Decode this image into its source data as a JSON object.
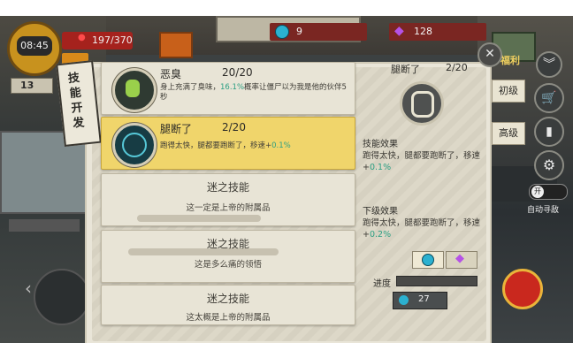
{
  "hud": {
    "time": "08:45",
    "health": "197/370",
    "level": "13",
    "coins": "9",
    "gems": "128"
  },
  "right_menu": {
    "welfare": "福利",
    "beginner": "初级",
    "advanced": "高级",
    "toggle_on": "开",
    "auto_path": "自动寻敌"
  },
  "panel": {
    "title": "技能开发"
  },
  "skills": [
    {
      "name": "恶臭",
      "level": "20/20",
      "desc_a": "身上充满了臭味，",
      "desc_hl": "16.1%",
      "desc_b": "概率让僵尸以为我是他的伙伴5秒"
    },
    {
      "name": "腿断了",
      "level": "2/20",
      "desc_a": "跑得太快，腿都要跑断了，移速+",
      "desc_hl": "0.1%"
    },
    {
      "name": "迷之技能",
      "desc": "这一定是上帝的附属品"
    },
    {
      "name": "迷之技能",
      "desc": "这是多么痛的领悟"
    },
    {
      "name": "迷之技能",
      "desc": "这太概是上帝的附属品"
    }
  ],
  "detail": {
    "name": "腿断了",
    "level": "2/20",
    "effect_heading": "技能效果",
    "effect_a": "跑得太快，腿都要跑断了，移速+",
    "effect_hl": "0.1%",
    "next_heading": "下级效果",
    "next_a": "跑得太快，腿都要跑断了，移速+",
    "next_hl": "0.2%"
  },
  "upgrade": {
    "progress_label": "进度",
    "cost": "27"
  }
}
